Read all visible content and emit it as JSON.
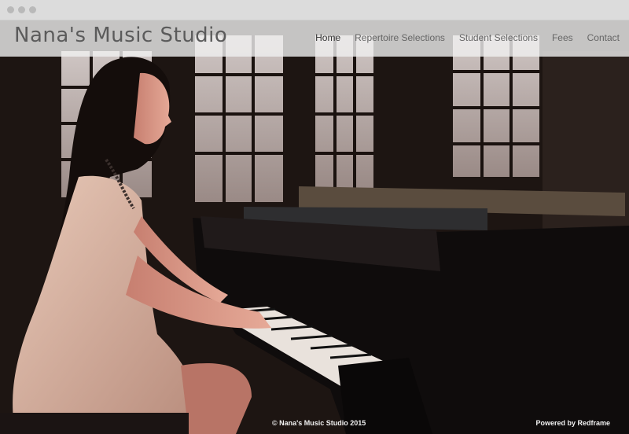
{
  "site": {
    "title": "Nana's Music Studio"
  },
  "nav": {
    "items": [
      {
        "label": "Home"
      },
      {
        "label": "Repertoire Selections"
      },
      {
        "label": "Student Selections"
      },
      {
        "label": "Fees"
      },
      {
        "label": "Contact"
      }
    ],
    "active": "Home"
  },
  "footer": {
    "copyright": "© Nana's Music Studio 2015",
    "powered_by": "Powered by Redframe"
  },
  "hero": {
    "image": "woman-playing-grand-piano-photo"
  },
  "colors": {
    "nav_bg": "#f0f0f0",
    "title_text": "#5b5b5b",
    "nav_text": "#666666",
    "footer_text": "#f2f2f2"
  }
}
